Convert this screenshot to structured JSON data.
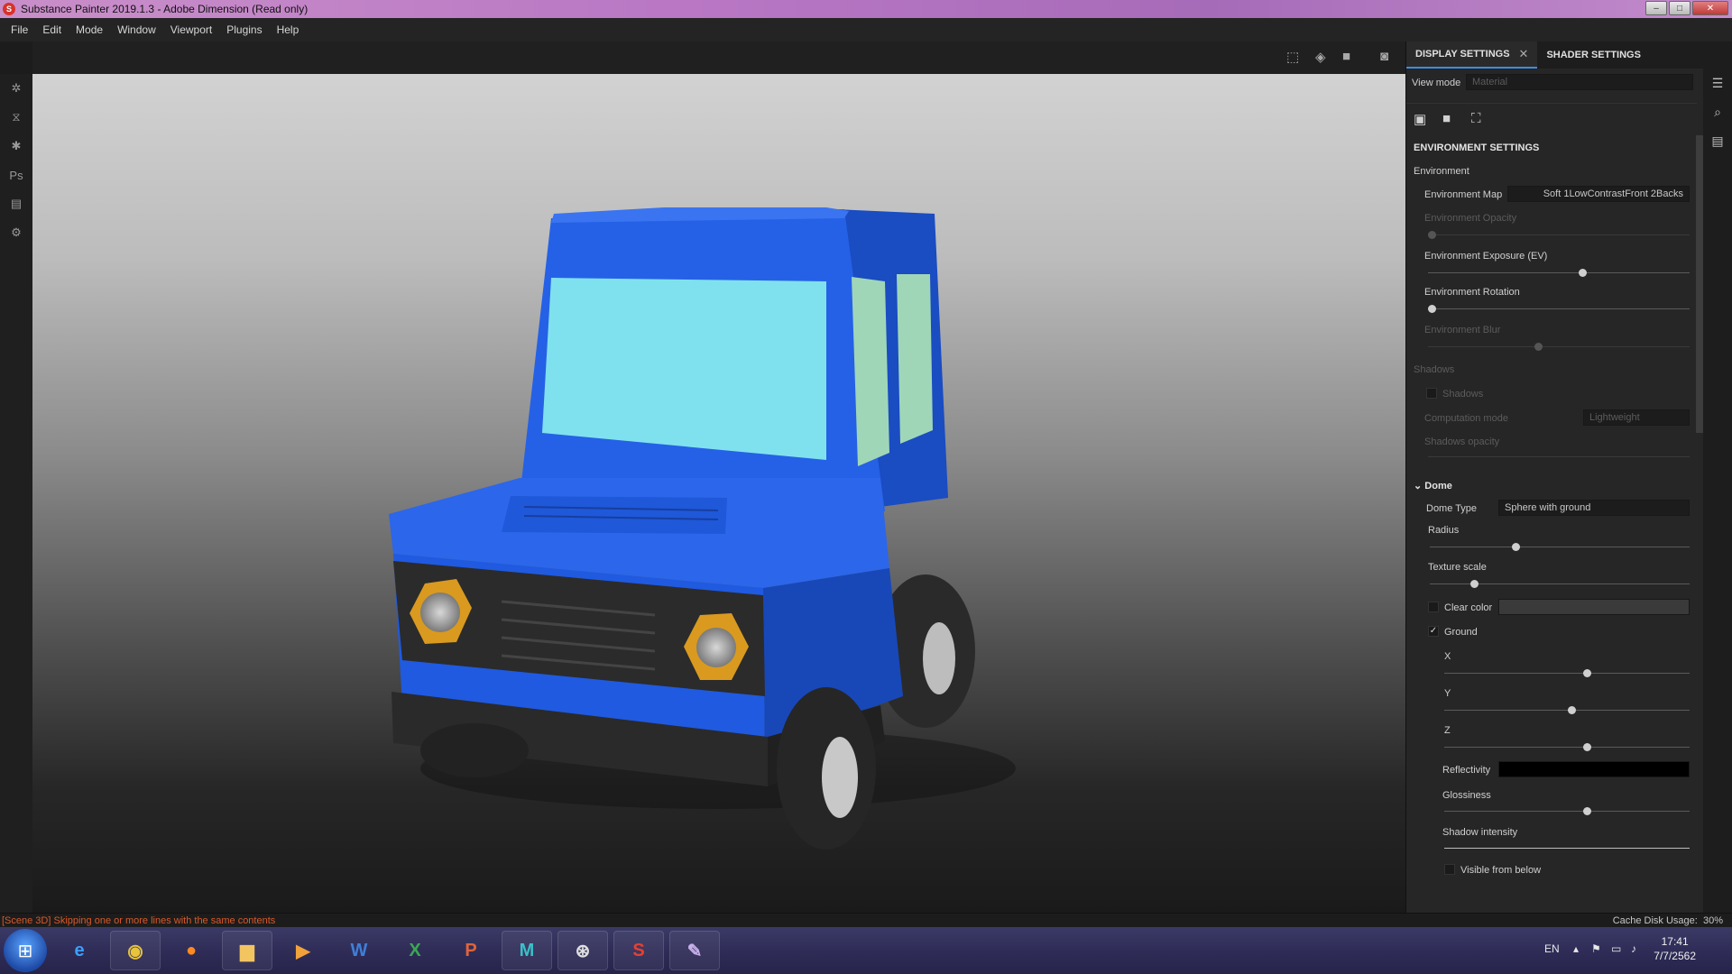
{
  "window": {
    "title": "Substance Painter 2019.1.3 - Adobe Dimension (Read only)",
    "app_icon": "substance-s-icon"
  },
  "menu": [
    "File",
    "Edit",
    "Mode",
    "Window",
    "Viewport",
    "Plugins",
    "Help"
  ],
  "panel": {
    "tabs": [
      {
        "label": "DISPLAY SETTINGS",
        "active": true
      },
      {
        "label": "SHADER SETTINGS",
        "active": false
      }
    ],
    "view_mode": {
      "label": "View mode",
      "value": "Material"
    },
    "environment": {
      "section_title": "ENVIRONMENT SETTINGS",
      "group": "Environment",
      "map_label": "Environment Map",
      "map_value": "Soft 1LowContrastFront 2Backs",
      "opacity_label": "Environment Opacity",
      "opacity_value": 0.0,
      "exposure_label": "Environment Exposure (EV)",
      "exposure_value": 0.59,
      "rotation_label": "Environment Rotation",
      "rotation_value": 0.0,
      "blur_label": "Environment Blur",
      "blur_value": 0.42
    },
    "shadows": {
      "group": "Shadows",
      "toggle_label": "Shadows",
      "mode_label": "Computation mode",
      "mode_value": "Lightweight",
      "opacity_label": "Shadows opacity"
    },
    "dome": {
      "title": "Dome",
      "type_label": "Dome Type",
      "type_value": "Sphere with ground",
      "radius_label": "Radius",
      "radius_value": 0.33,
      "texture_label": "Texture scale",
      "texture_value": 0.17,
      "clear_label": "Clear color",
      "ground_label": "Ground",
      "x_label": "X",
      "x_value": 0.58,
      "y_label": "Y",
      "y_value": 0.52,
      "z_label": "Z",
      "z_value": 0.58,
      "reflectivity_label": "Reflectivity",
      "glossiness_label": "Glossiness",
      "glossiness_value": 0.58,
      "shadow_label": "Shadow intensity",
      "shadow_value": 1.0,
      "visible_label": "Visible from below"
    }
  },
  "status": {
    "message": "[Scene 3D] Skipping one or more lines with the same contents",
    "cache": "Cache Disk Usage:",
    "cache_value": "30%"
  },
  "taskbar": {
    "lang": "EN",
    "time": "17:41",
    "date": "7/7/2562",
    "apps": [
      "internet-explorer-icon",
      "chrome-icon",
      "firefox-icon",
      "explorer-icon",
      "media-player-icon",
      "word-icon",
      "excel-icon",
      "powerpoint-icon",
      "maya-icon",
      "steam-icon",
      "substance-painter-icon",
      "paint-icon"
    ],
    "word_letter": "W",
    "excel_letter": "X",
    "ppt_letter": "P",
    "maya_letter": "M"
  },
  "colors": {
    "accent": "#3a8ee6",
    "car_body": "#1f5fe0",
    "status_error": "#d85a2a"
  }
}
